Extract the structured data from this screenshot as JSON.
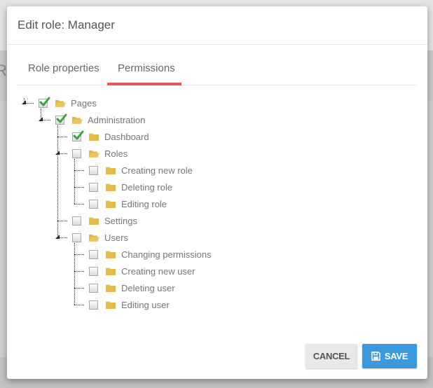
{
  "background": {
    "partial_heading": "Ro"
  },
  "modal": {
    "title": "Edit role: Manager",
    "tabs": [
      {
        "label": "Role properties",
        "active": false
      },
      {
        "label": "Permissions",
        "active": true
      }
    ],
    "tab_accent_color": "#e4575d",
    "tree": [
      {
        "label": "Pages",
        "checked": true,
        "expanded": true,
        "depth": 0
      },
      {
        "label": "Administration",
        "checked": true,
        "expanded": true,
        "depth": 1
      },
      {
        "label": "Dashboard",
        "checked": true,
        "expanded": false,
        "depth": 2
      },
      {
        "label": "Roles",
        "checked": false,
        "expanded": true,
        "depth": 2
      },
      {
        "label": "Creating new role",
        "checked": false,
        "expanded": false,
        "depth": 3
      },
      {
        "label": "Deleting role",
        "checked": false,
        "expanded": false,
        "depth": 3
      },
      {
        "label": "Editing role",
        "checked": false,
        "expanded": false,
        "depth": 3
      },
      {
        "label": "Settings",
        "checked": false,
        "expanded": false,
        "depth": 2
      },
      {
        "label": "Users",
        "checked": false,
        "expanded": true,
        "depth": 2
      },
      {
        "label": "Changing permissions",
        "checked": false,
        "expanded": false,
        "depth": 3
      },
      {
        "label": "Creating new user",
        "checked": false,
        "expanded": false,
        "depth": 3
      },
      {
        "label": "Deleting user",
        "checked": false,
        "expanded": false,
        "depth": 3
      },
      {
        "label": "Editing user",
        "checked": false,
        "expanded": false,
        "depth": 3
      }
    ],
    "buttons": {
      "cancel": "CANCEL",
      "save": "SAVE",
      "save_icon": "floppy-disk-icon",
      "save_color": "#3a98dc"
    }
  }
}
